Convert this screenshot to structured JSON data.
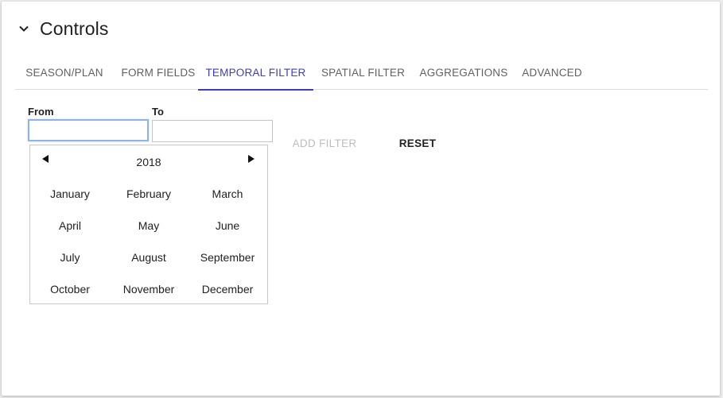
{
  "section": {
    "title": "Controls"
  },
  "tabs": [
    {
      "label": "SEASON/PLAN"
    },
    {
      "label": "FORM FIELDS"
    },
    {
      "label": "TEMPORAL FILTER"
    },
    {
      "label": "SPATIAL FILTER"
    },
    {
      "label": "AGGREGATIONS"
    },
    {
      "label": "ADVANCED"
    }
  ],
  "active_tab": "TEMPORAL FILTER",
  "filter": {
    "from_label": "From",
    "from_value": "",
    "to_label": "To",
    "to_value": "",
    "add_filter_label": "ADD FILTER",
    "reset_label": "RESET"
  },
  "picker": {
    "year": "2018",
    "months": [
      "January",
      "February",
      "March",
      "April",
      "May",
      "June",
      "July",
      "August",
      "September",
      "October",
      "November",
      "December"
    ]
  },
  "colors": {
    "accent": "#3f3dbf",
    "focus_border": "#8cb4ea"
  },
  "icons": {
    "collapse": "chevron-down-icon",
    "prev": "triangle-left-icon",
    "next": "triangle-right-icon"
  }
}
